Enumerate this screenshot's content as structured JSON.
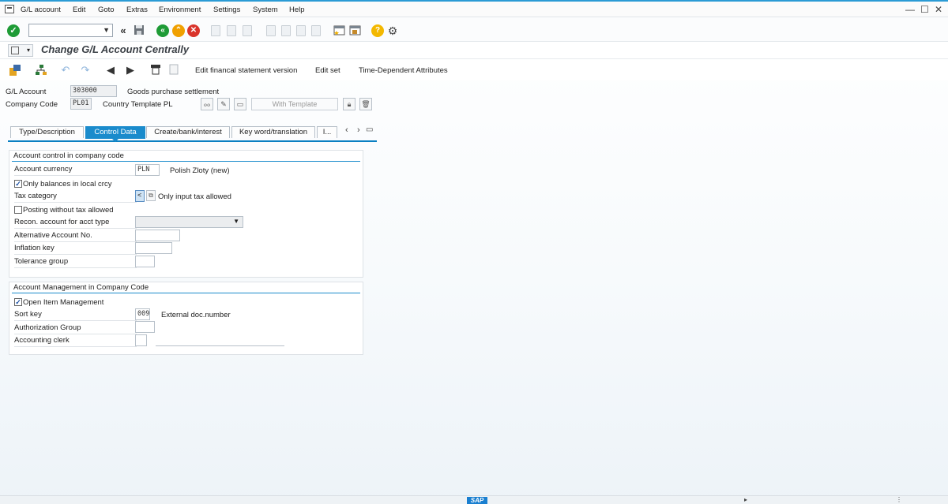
{
  "menu": {
    "items": [
      "G/L account",
      "Edit",
      "Goto",
      "Extras",
      "Environment",
      "Settings",
      "System",
      "Help"
    ],
    "window_controls": [
      "—",
      "☐",
      "✕"
    ]
  },
  "toolbar": {
    "command_field_value": "",
    "icons": [
      "check-icon",
      "back-double-icon",
      "save-icon",
      "back-icon",
      "exit-icon",
      "cancel-icon",
      "print-icon",
      "find-icon",
      "find-next-icon",
      "first-page-icon",
      "prev-page-icon",
      "next-page-icon",
      "last-page-icon",
      "new-session-icon",
      "shortcut-icon",
      "help-icon",
      "settings-icon"
    ]
  },
  "title": "Change G/L Account Centrally",
  "app_toolbar": {
    "buttons": [
      "Edit financal statement version",
      "Edit set",
      "Time-Dependent Attributes"
    ]
  },
  "header": {
    "gl_account_label": "G/L Account",
    "gl_account_value": "303000",
    "gl_account_desc": "Goods purchase settlement",
    "company_code_label": "Company Code",
    "company_code_value": "PL01",
    "company_code_desc": "Country Template PL",
    "with_template_label": "With Template"
  },
  "tabs": [
    {
      "label": "Type/Description",
      "active": false
    },
    {
      "label": "Control Data",
      "active": true
    },
    {
      "label": "Create/bank/interest",
      "active": false
    },
    {
      "label": "Key word/translation",
      "active": false
    },
    {
      "label": "I...",
      "active": false
    }
  ],
  "account_control": {
    "title": "Account control in company code",
    "account_currency_label": "Account currency",
    "account_currency_value": "PLN",
    "account_currency_desc": "Polish Zloty (new)",
    "only_balances_label": "Only balances in local crcy",
    "only_balances_checked": true,
    "tax_category_label": "Tax category",
    "tax_category_value": "<",
    "tax_category_desc": "Only input tax allowed",
    "posting_without_tax_label": "Posting without tax allowed",
    "posting_without_tax_checked": false,
    "recon_label": "Recon. account for acct type",
    "recon_value": "",
    "alt_account_label": "Alternative Account No.",
    "alt_account_value": "",
    "inflation_key_label": "Inflation key",
    "inflation_key_value": "",
    "tolerance_group_label": "Tolerance group",
    "tolerance_group_value": ""
  },
  "account_management": {
    "title": "Account Management in Company Code",
    "open_item_label": "Open Item Management",
    "open_item_checked": true,
    "sort_key_label": "Sort key",
    "sort_key_value": "009",
    "sort_key_desc": "External doc.number",
    "auth_group_label": "Authorization Group",
    "auth_group_value": "",
    "acct_clerk_label": "Accounting clerk",
    "acct_clerk_value": ""
  },
  "status": {
    "logo": "SAP"
  },
  "colors": {
    "accent": "#1a8bcc",
    "ok_green": "#1e9b36",
    "exit_orange": "#f0a000",
    "cancel_red": "#d9342b",
    "help_yellow": "#f3b800"
  }
}
